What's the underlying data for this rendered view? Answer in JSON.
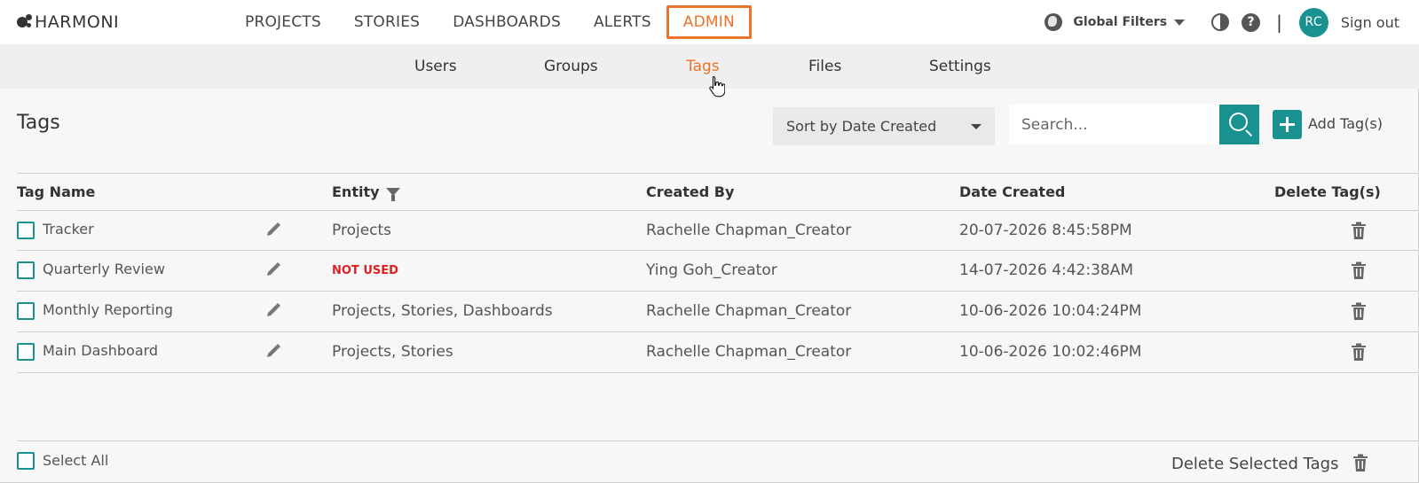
{
  "brand": {
    "name": "HARMONI"
  },
  "main_nav": [
    {
      "label": "PROJECTS"
    },
    {
      "label": "STORIES"
    },
    {
      "label": "DASHBOARDS"
    },
    {
      "label": "ALERTS"
    },
    {
      "label": "ADMIN",
      "active": true
    }
  ],
  "right_nav": {
    "global_filters": "Global Filters",
    "help": "?",
    "separator": "|",
    "avatar_initials": "RC",
    "sign_out": "Sign out"
  },
  "sub_nav": [
    {
      "label": "Users"
    },
    {
      "label": "Groups"
    },
    {
      "label": "Tags",
      "active": true
    },
    {
      "label": "Files"
    },
    {
      "label": "Settings"
    }
  ],
  "page": {
    "title": "Tags",
    "sort_value": "Sort by Date Created",
    "search_placeholder": "Search...",
    "add_label": "Add Tag(s)"
  },
  "table": {
    "headers": {
      "tag_name": "Tag Name",
      "entity": "Entity",
      "created_by": "Created By",
      "date_created": "Date Created",
      "delete": "Delete Tag(s)"
    },
    "rows": [
      {
        "tag_name": "Tracker",
        "entity": "Projects",
        "created_by": "Rachelle Chapman_Creator",
        "date_created": "20-07-2026 8:45:58PM"
      },
      {
        "tag_name": "Quarterly Review",
        "entity": "NOT USED",
        "created_by": "Ying Goh_Creator",
        "date_created": "14-07-2026 4:42:38AM"
      },
      {
        "tag_name": "Monthly Reporting",
        "entity": "Projects, Stories, Dashboards",
        "created_by": "Rachelle Chapman_Creator",
        "date_created": "10-06-2026 10:04:24PM"
      },
      {
        "tag_name": "Main Dashboard",
        "entity": "Projects, Stories",
        "created_by": "Rachelle Chapman_Creator",
        "date_created": "10-06-2026 10:02:46PM"
      }
    ]
  },
  "footer": {
    "select_all": "Select All",
    "delete_selected": "Delete Selected Tags"
  },
  "colors": {
    "accent": "#e8742a",
    "teal": "#1a9191",
    "warning": "#e02020"
  }
}
